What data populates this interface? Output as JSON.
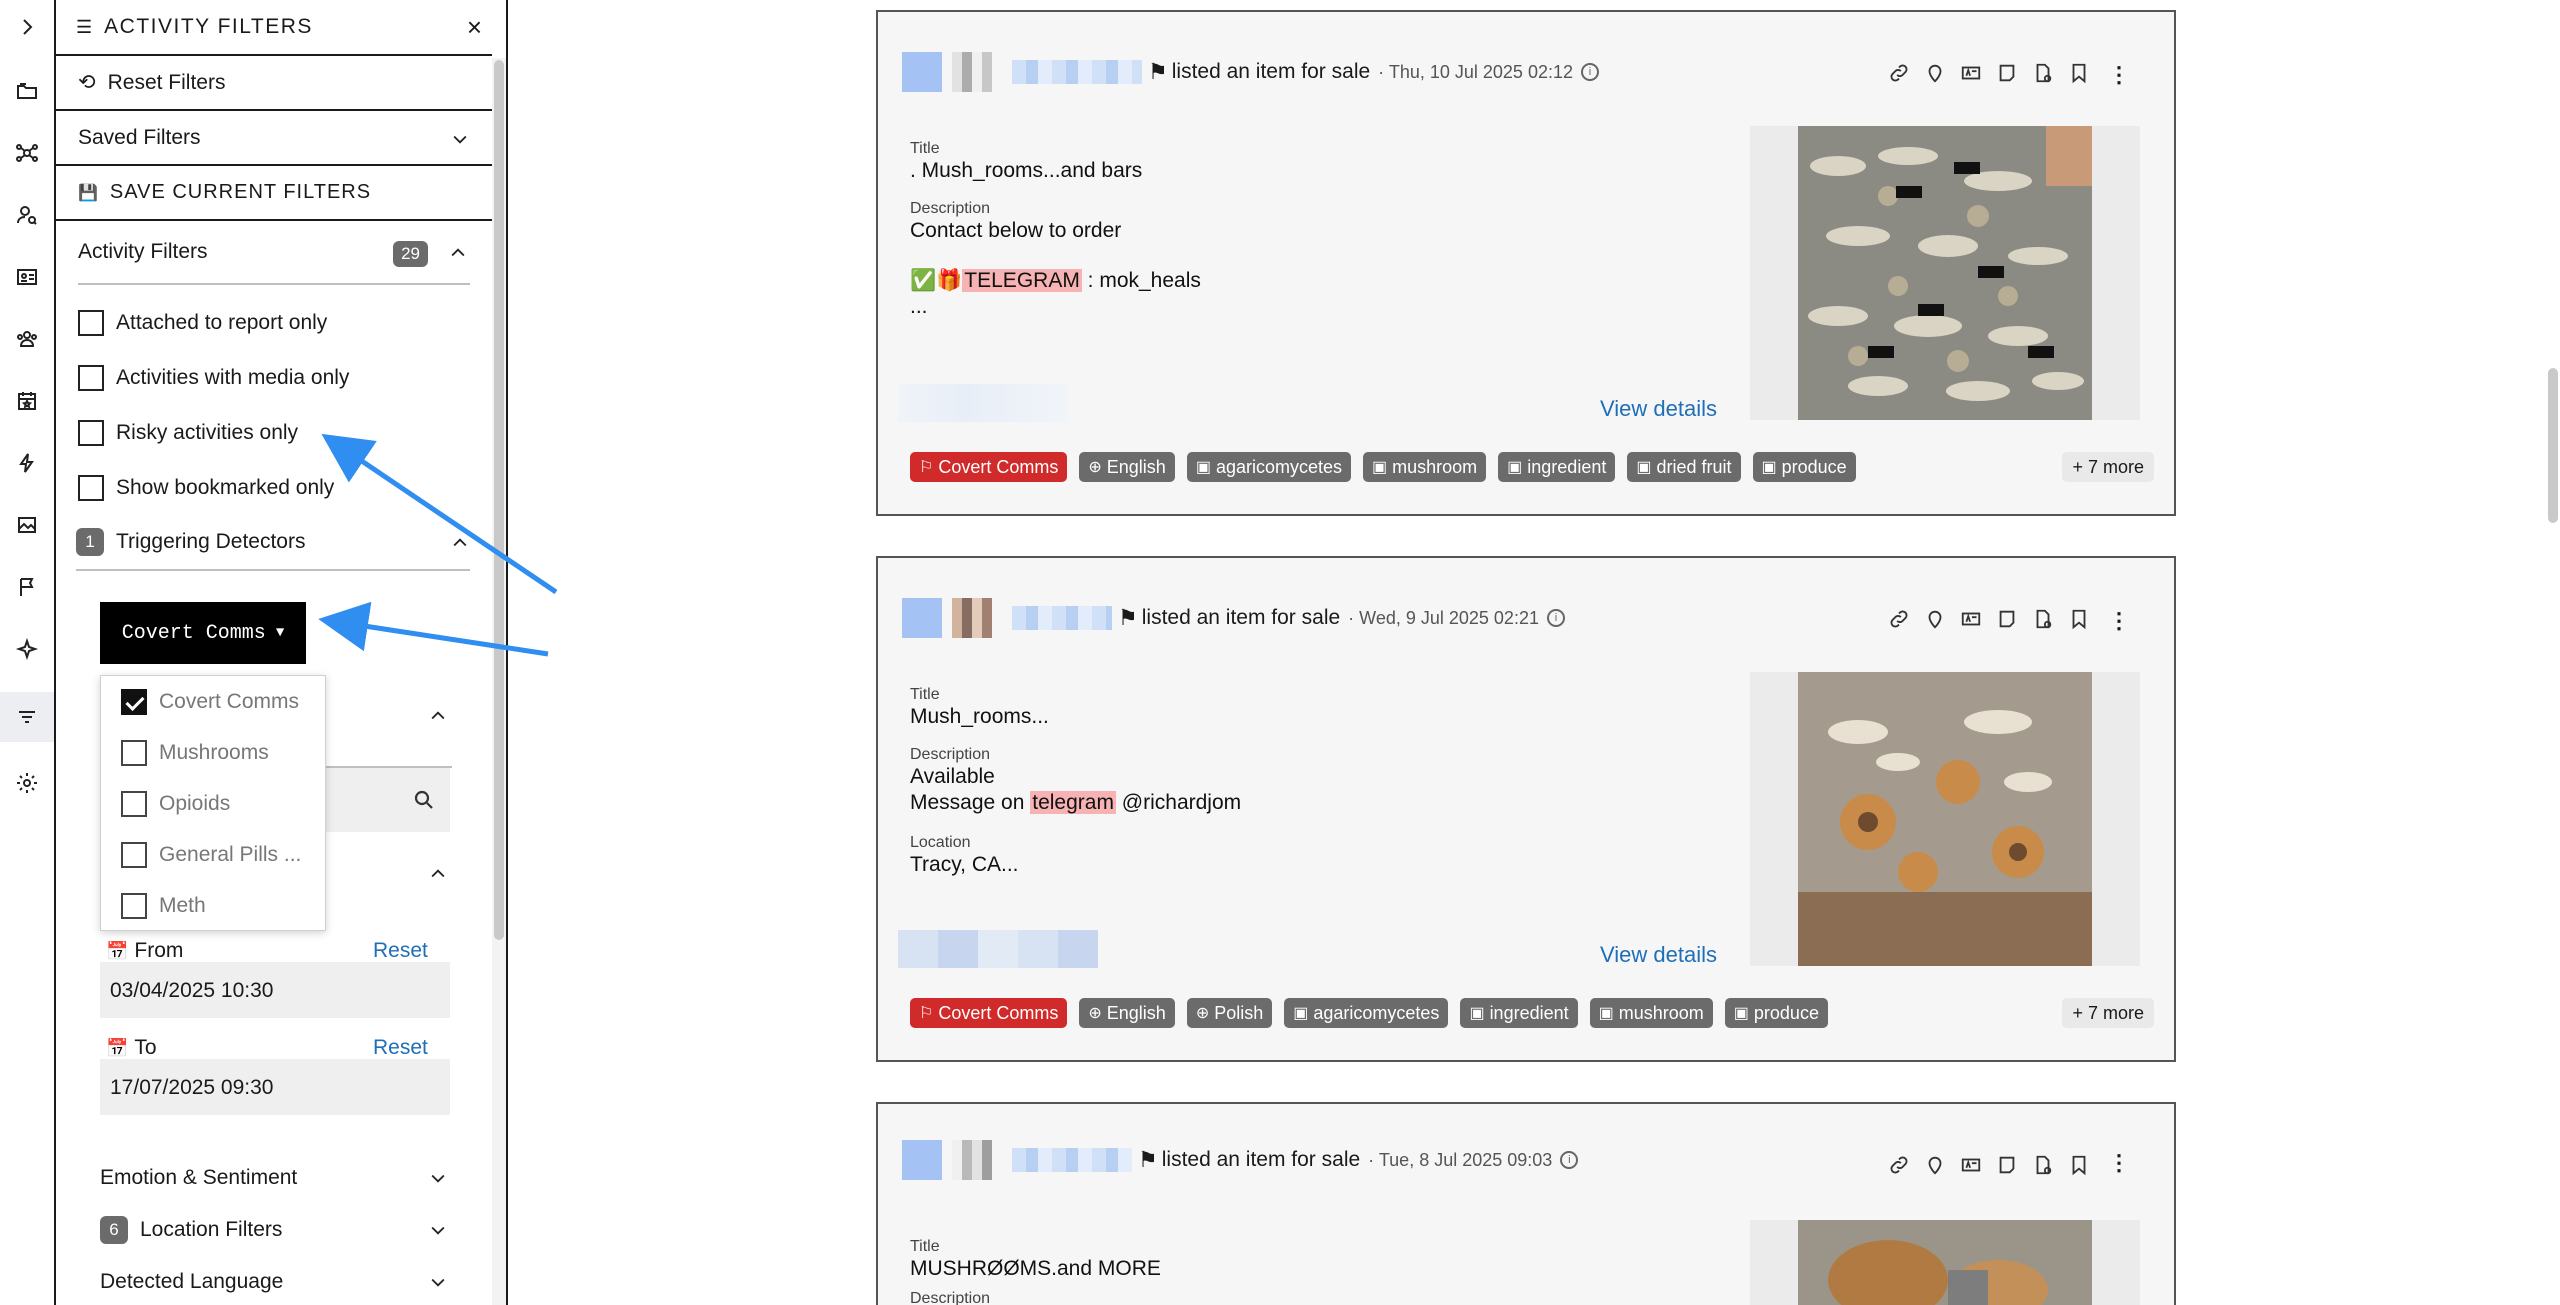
{
  "panel": {
    "title": "ACTIVITY FILTERS",
    "close": "×",
    "reset_filters": "Reset Filters",
    "saved_filters": "Saved Filters",
    "save_current": "SAVE CURRENT FILTERS",
    "activity_filters": "Activity Filters",
    "activity_filters_count": "29",
    "checkboxes": [
      {
        "label": "Attached to report only"
      },
      {
        "label": "Activities with media only"
      },
      {
        "label": "Risky activities only"
      },
      {
        "label": "Show bookmarked only"
      }
    ],
    "triggering": {
      "count": "1",
      "label": "Triggering Detectors"
    },
    "dropdown_button": "Covert Comms",
    "dropdown_options": [
      {
        "label": "Covert Comms",
        "checked": true
      },
      {
        "label": "Mushrooms",
        "checked": false
      },
      {
        "label": "Opioids",
        "checked": false
      },
      {
        "label": "General Pills ...",
        "checked": false
      },
      {
        "label": "Meth",
        "checked": false
      }
    ],
    "date_from_label": "From",
    "date_from_value": "03/04/2025 10:30",
    "date_to_label": "To",
    "date_to_value": "17/07/2025 09:30",
    "reset_label": "Reset",
    "emotion": "Emotion & Sentiment",
    "location": {
      "count": "6",
      "label": "Location Filters"
    },
    "language": "Detected Language"
  },
  "feed": [
    {
      "action": "listed an item for sale",
      "timestamp": "· Thu, 10 Jul 2025 02:12",
      "title_label": "Title",
      "title": ". Mush_rooms...and bars",
      "desc_label": "Description",
      "desc_line1": "Contact below to order",
      "desc_line2_prefix": "✅🎁",
      "desc_line2_hl": "TELEGRAM",
      "desc_line2_suffix": " : mok_heals",
      "desc_line3": "...",
      "view_details": "View details",
      "tags": [
        "Covert Comms",
        "English",
        "agaricomycetes",
        "mushroom",
        "ingredient",
        "dried fruit",
        "produce"
      ],
      "more": "+  7 more"
    },
    {
      "action": "listed an item for sale",
      "timestamp": "· Wed, 9 Jul 2025 02:21",
      "title_label": "Title",
      "title": "Mush_rooms...",
      "desc_label": "Description",
      "desc_line1": "Available",
      "desc_line2_prefix": "Message on ",
      "desc_line2_hl": "telegram",
      "desc_line2_suffix": " @richardjom",
      "loc_label": "Location",
      "location": "Tracy, CA...",
      "view_details": "View details",
      "tags": [
        "Covert Comms",
        "English",
        "Polish",
        "agaricomycetes",
        "ingredient",
        "mushroom",
        "produce"
      ],
      "more": "+  7 more"
    },
    {
      "action": "listed an item for sale",
      "timestamp": "· Tue, 8 Jul 2025 09:03",
      "title_label": "Title",
      "title": "MUSHRØØMS.and MORE",
      "desc_label": "Description"
    }
  ],
  "colors": {
    "accent_link": "#1f6fb8",
    "tag_red": "#d12a2a",
    "tag_gray": "#6b6b6b",
    "highlight": "#f7b3b3",
    "arrow": "#2f8ef0"
  }
}
